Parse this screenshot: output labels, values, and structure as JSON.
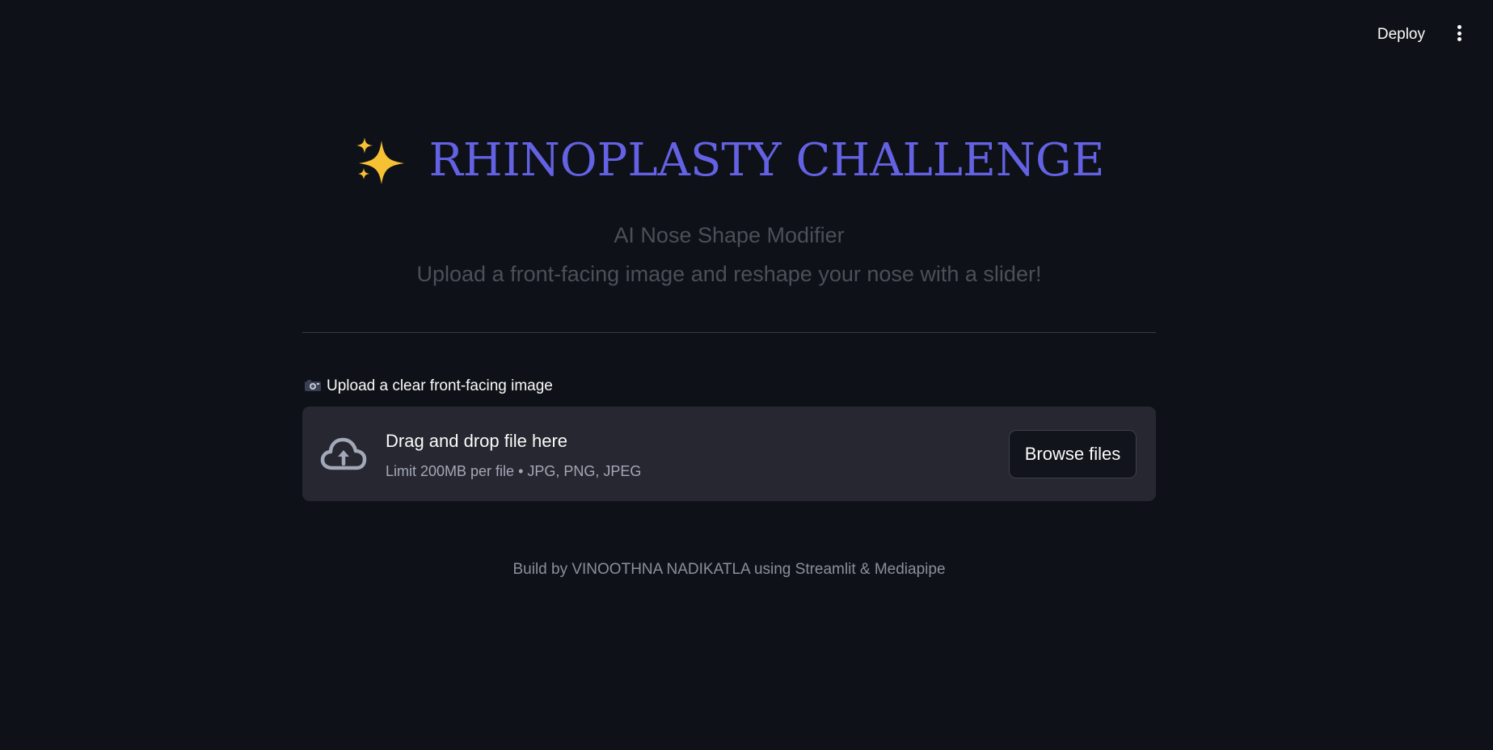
{
  "header": {
    "deploy_label": "Deploy",
    "menu_icon": "vertical-ellipsis-icon"
  },
  "hero": {
    "sparkle_icon": "sparkles-emoji",
    "title": "RHINOPLASTY CHALLENGE",
    "title_color": "#6462e4",
    "subtitle_line1": "AI Nose Shape Modifier",
    "subtitle_line2": "Upload a front-facing image and reshape your nose with a slider!"
  },
  "uploader": {
    "label_icon": "camera-emoji",
    "label": "Upload a clear front-facing image",
    "icon": "cloud-upload-icon",
    "drop_title": "Drag and drop file here",
    "drop_limit": "Limit 200MB per file • JPG, PNG, JPEG",
    "browse_label": "Browse files"
  },
  "footer": {
    "text": "Build by VINOOTHNA NADIKATLA using Streamlit & Mediapipe"
  },
  "colors": {
    "background": "#0e1117",
    "dropzone": "#262730",
    "accent": "#6462e4"
  }
}
